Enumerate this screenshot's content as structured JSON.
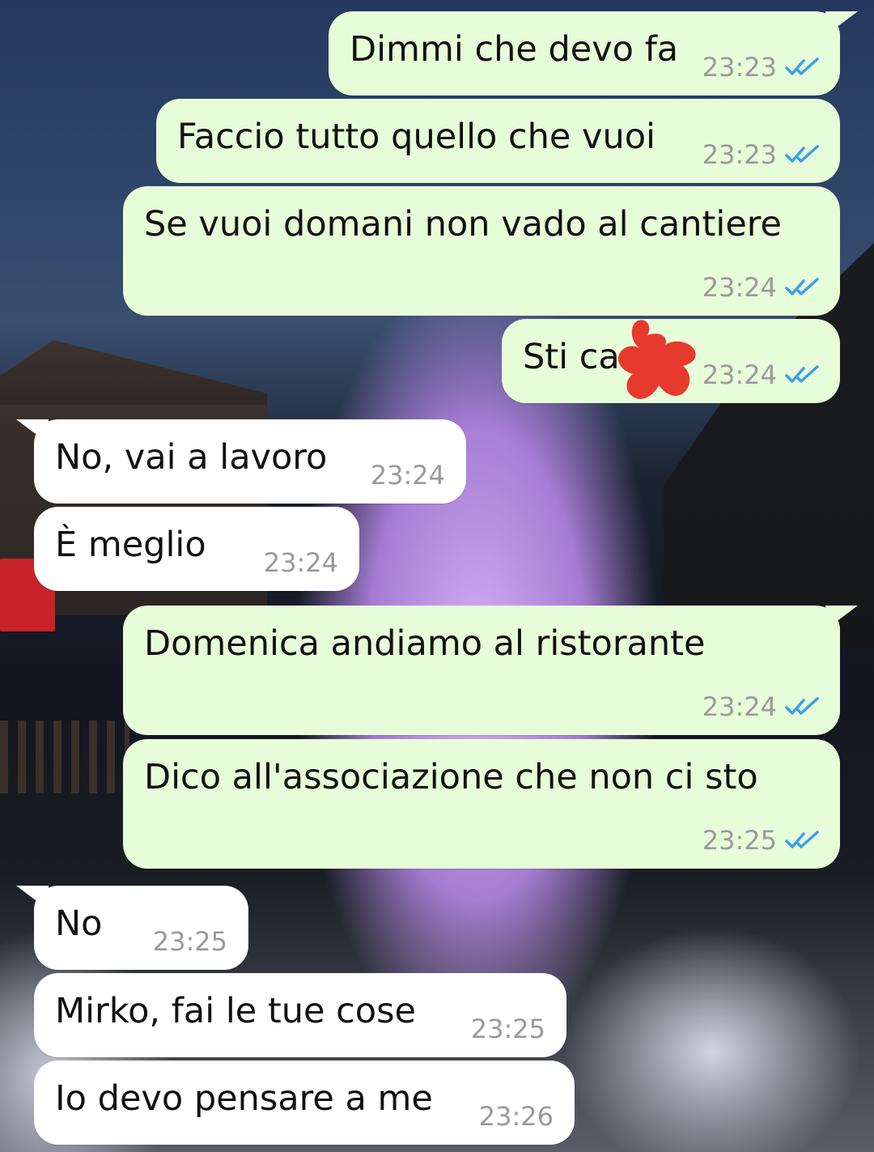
{
  "colors": {
    "outgoing_bubble": "#e7fcd8",
    "incoming_bubble": "#ffffff",
    "read_tick": "#3aa0e8",
    "timestamp": "#9a9a9a",
    "redaction": "#e63a2e"
  },
  "messages": [
    {
      "direction": "out",
      "text": "Dimmi che devo fa",
      "time": "23:23",
      "status": "read"
    },
    {
      "direction": "out",
      "text": "Faccio tutto quello che vuoi",
      "time": "23:23",
      "status": "read"
    },
    {
      "direction": "out",
      "text": "Se vuoi domani non vado al cantiere",
      "time": "23:24",
      "status": "read"
    },
    {
      "direction": "out",
      "text": "Sti ca",
      "time": "23:24",
      "status": "read",
      "redacted": true
    },
    {
      "direction": "in",
      "text": "No, vai a lavoro",
      "time": "23:24"
    },
    {
      "direction": "in",
      "text": "È meglio",
      "time": "23:24"
    },
    {
      "direction": "out",
      "text": "Domenica andiamo al ristorante",
      "time": "23:24",
      "status": "read"
    },
    {
      "direction": "out",
      "text": "Dico all'associazione che non ci sto",
      "time": "23:25",
      "status": "read"
    },
    {
      "direction": "in",
      "text": "No",
      "time": "23:25"
    },
    {
      "direction": "in",
      "text": "Mirko, fai le tue cose",
      "time": "23:25"
    },
    {
      "direction": "in",
      "text": "Io devo pensare a me",
      "time": "23:26"
    }
  ]
}
